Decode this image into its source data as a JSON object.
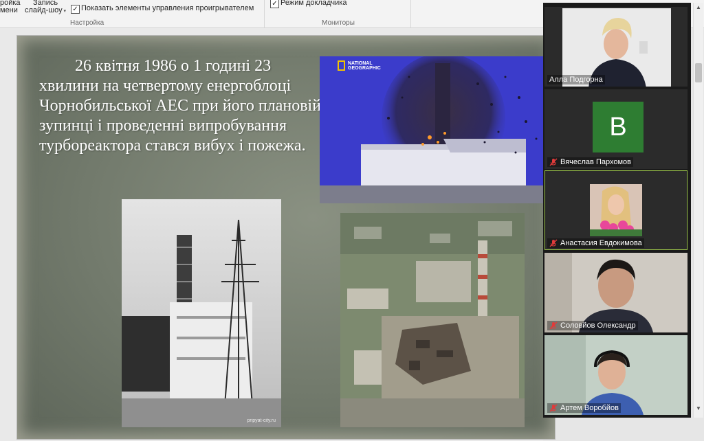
{
  "ribbon": {
    "cut_left_top": "ройка",
    "cut_left_bottom": "мени",
    "record_top": "Запись",
    "record_bottom": "слайд-шоу",
    "show_controls_label": "Показать элементы управления проигрывателем",
    "show_controls_checked": "✓",
    "group_setup": "Настройка",
    "presenter_mode_label": "Режим докладчика",
    "presenter_mode_checked": "✓",
    "group_monitors": "Мониторы"
  },
  "slide": {
    "text": "26 квітня 1986 о 1 годині 23 хвилини на четвертому енергоблоці Чорнобильської АЕС при його плановій зупинці і проведенні випробування турбореактора стався вибух і пожежа.",
    "photo1_logo": "NATIONAL GEOGRAPHIC",
    "photo2_watermark": "pripyat-city.ru"
  },
  "participants": [
    {
      "name": "Алла Подгорна",
      "muted": false
    },
    {
      "name": "Вячеслав Пархомов",
      "muted": true,
      "avatar_letter": "В"
    },
    {
      "name": "Анастасия Евдокимова",
      "muted": true
    },
    {
      "name": "Соловйов Олександр",
      "muted": true
    },
    {
      "name": "Артем Воробйов",
      "muted": true
    }
  ],
  "colors": {
    "avatar_green": "#2e7d32",
    "active_border": "#9ac34a",
    "mic_muted": "#e03b3b"
  }
}
